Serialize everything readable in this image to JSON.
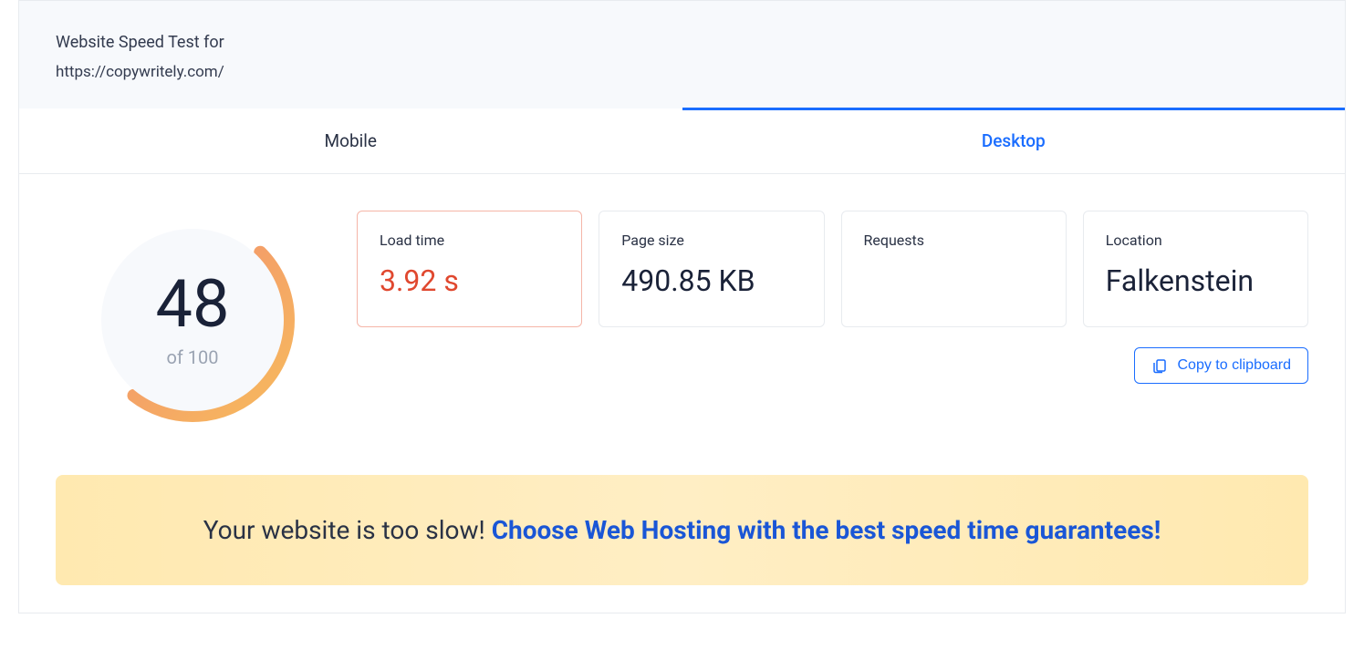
{
  "header": {
    "title": "Website Speed Test for",
    "url": "https://copywritely.com/"
  },
  "tabs": {
    "mobile": "Mobile",
    "desktop": "Desktop",
    "active": "desktop"
  },
  "score": {
    "value": "48",
    "of_label": "of 100",
    "percent": 48
  },
  "metrics": {
    "load_time": {
      "label": "Load time",
      "value": "3.92 s"
    },
    "page_size": {
      "label": "Page size",
      "value": "490.85 KB"
    },
    "requests": {
      "label": "Requests",
      "value": ""
    },
    "location": {
      "label": "Location",
      "value": "Falkenstein"
    }
  },
  "actions": {
    "copy_label": "Copy to clipboard"
  },
  "banner": {
    "lead": "Your website is too slow! ",
    "cta": "Choose Web Hosting with the best speed time guarantees!"
  },
  "colors": {
    "accent": "#1a6dff",
    "warn": "#e0482f",
    "gauge_start": "#f28e6f",
    "gauge_end": "#f6b360"
  }
}
